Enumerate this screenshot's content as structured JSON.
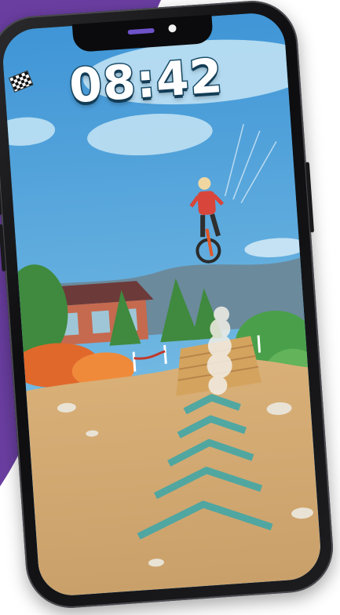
{
  "hud": {
    "timer": "08:42",
    "flag_icon": "checkered-flag-icon"
  },
  "colors": {
    "background_accent": "#6a3ea1",
    "sky": "#4fa3dd",
    "timer_text": "#ffffff",
    "timer_outline": "#1a4d6a",
    "track_marker": "#3ba7a9"
  }
}
